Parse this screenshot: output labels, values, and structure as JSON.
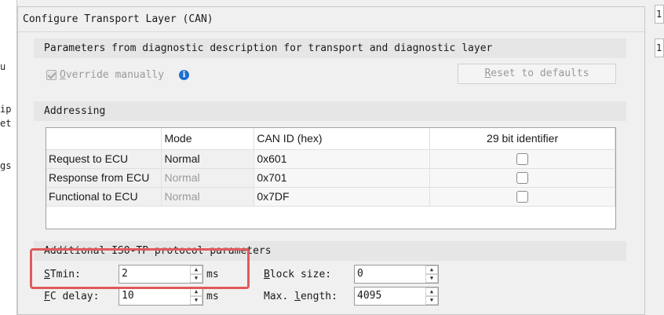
{
  "left_window": {
    "fragments": [
      "u",
      "ip",
      "et",
      "gs"
    ]
  },
  "right_window": {
    "cells": [
      "1",
      "1"
    ]
  },
  "dialog": {
    "title": "Configure Transport Layer (CAN)",
    "params_section": {
      "header": "Parameters from diagnostic description for transport and diagnostic layer",
      "override": {
        "label_first": "O",
        "label_rest": "verride manually",
        "checked": true
      },
      "info_icon": "info-icon",
      "reset_label_first": "R",
      "reset_label_rest": "eset to defaults"
    },
    "addressing_section": {
      "header": "Addressing",
      "columns": [
        "",
        "Mode",
        "CAN ID (hex)",
        "29 bit identifier"
      ],
      "rows": [
        {
          "name": "Request to ECU",
          "mode": "Normal",
          "can_id": "0x601",
          "bit29": false
        },
        {
          "name": "Response from ECU",
          "mode": "Normal",
          "can_id": "0x701",
          "bit29": false
        },
        {
          "name": "Functional to ECU",
          "mode": "Normal",
          "can_id": "0x7DF",
          "bit29": false
        }
      ]
    },
    "isotp_section": {
      "header": "Additional ISO-TP protocol parameters",
      "stmin": {
        "label_first": "S",
        "label_rest": "Tmin:",
        "value": "2",
        "unit": "ms"
      },
      "fc_delay": {
        "label_first": "F",
        "label_rest": "C delay:",
        "value": "10",
        "unit": "ms"
      },
      "block_size": {
        "label_first": "B",
        "label_rest": "lock size:",
        "value": "0"
      },
      "max_length": {
        "label_pre": "Max. ",
        "label_first": "l",
        "label_rest": "ength:",
        "value": "4095"
      }
    }
  },
  "colors": {
    "highlight": "#e05a5a",
    "info": "#1e6fd0"
  }
}
